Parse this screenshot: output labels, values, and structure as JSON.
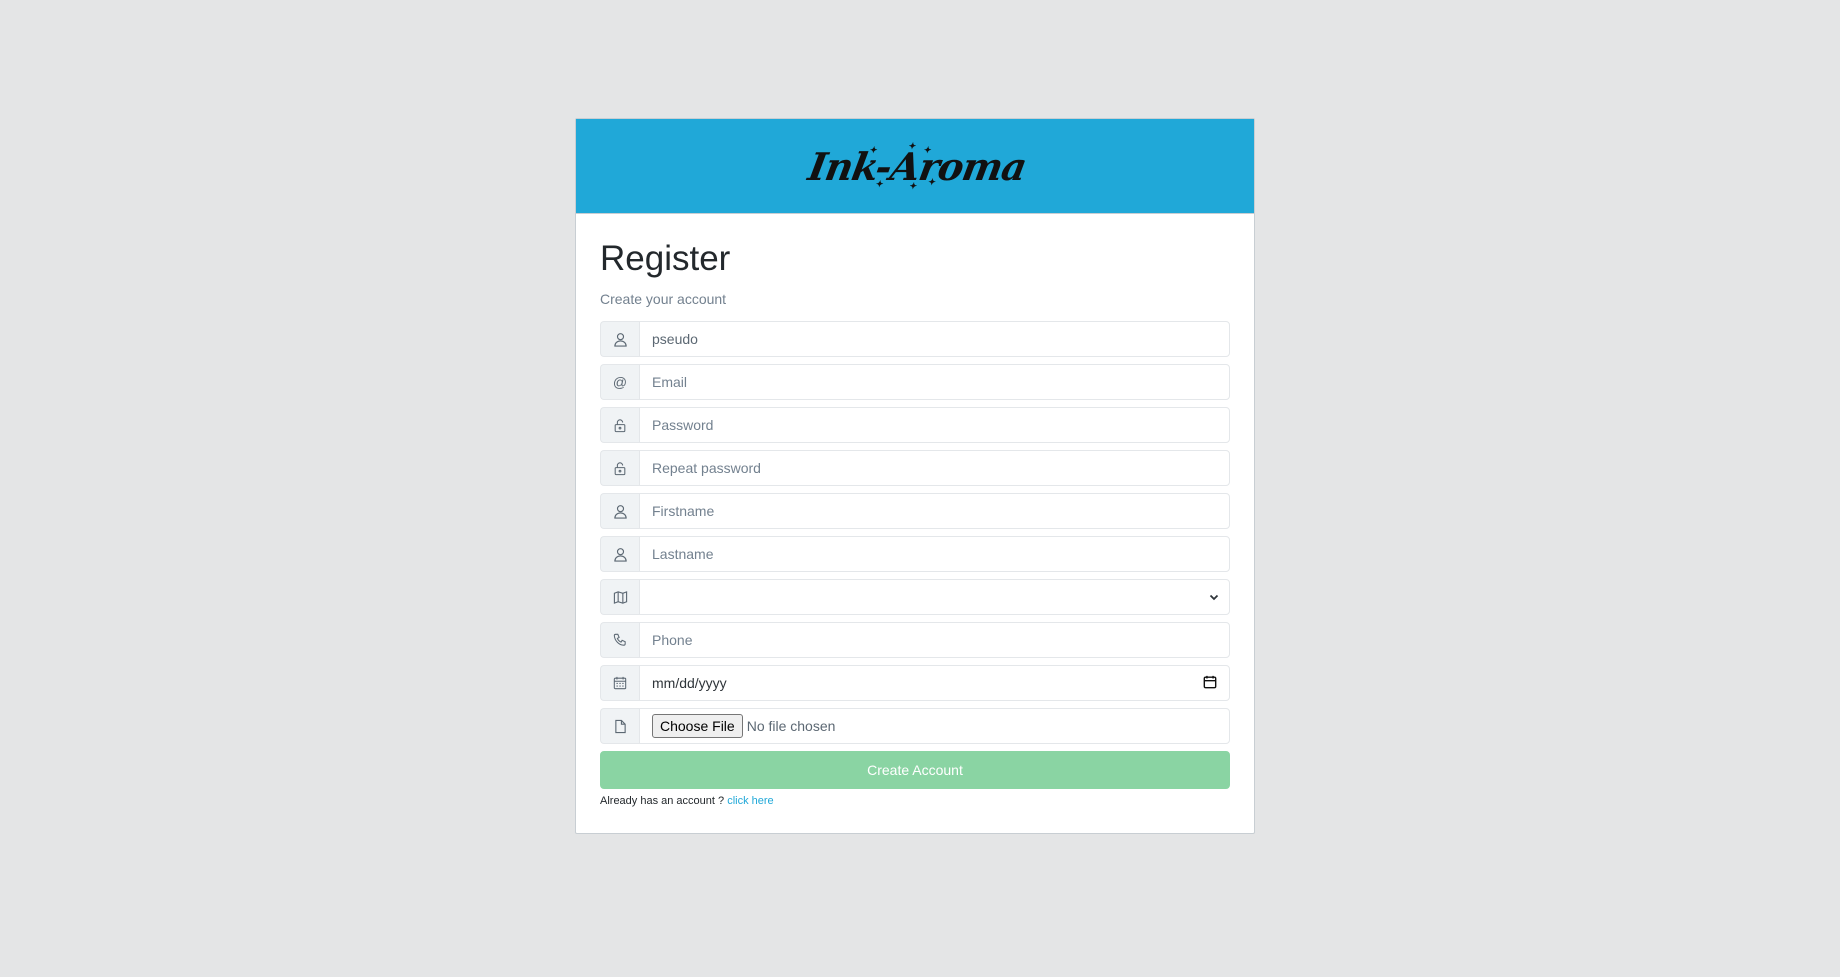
{
  "header": {
    "logo_text": "Ink-Aroma",
    "accent_color": "#20a8d8"
  },
  "form": {
    "title": "Register",
    "subtitle": "Create your account",
    "fields": {
      "pseudo": {
        "icon": "user-icon",
        "value": "pseudo"
      },
      "email": {
        "icon": "at-icon",
        "placeholder": "Email"
      },
      "password": {
        "icon": "lock-icon",
        "placeholder": "Password"
      },
      "repeat_password": {
        "icon": "lock-icon",
        "placeholder": "Repeat password"
      },
      "firstname": {
        "icon": "user-icon",
        "placeholder": "Firstname"
      },
      "lastname": {
        "icon": "user-icon",
        "placeholder": "Lastname"
      },
      "region": {
        "icon": "map-icon",
        "selected": ""
      },
      "phone": {
        "icon": "phone-icon",
        "placeholder": "Phone"
      },
      "birthdate": {
        "icon": "calendar-icon",
        "placeholder": "mm/dd/yyyy"
      },
      "file": {
        "icon": "file-icon",
        "button_label": "Choose File",
        "status": "No file chosen"
      }
    },
    "submit_label": "Create Account",
    "submit_color": "#8ad4a3",
    "login_prompt": "Already has an account ?",
    "login_link": "click here"
  }
}
